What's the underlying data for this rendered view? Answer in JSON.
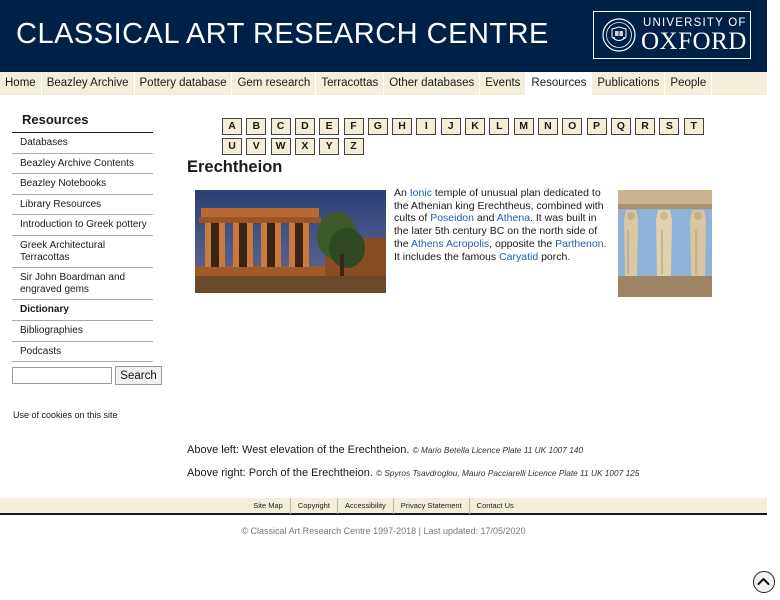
{
  "header": {
    "site_title": "CLASSICAL ART RESEARCH CENTRE",
    "university_of": "UNIVERSITY OF",
    "oxford": "OXFORD"
  },
  "nav": {
    "items": [
      "Home",
      "Beazley Archive",
      "Pottery database",
      "Gem research",
      "Terracottas",
      "Other databases",
      "Events",
      "Resources",
      "Publications",
      "People"
    ],
    "active": "Resources"
  },
  "sidebar": {
    "title": "Resources",
    "items": [
      "Databases",
      "Beazley Archive Contents",
      "Beazley Notebooks",
      "Library Resources",
      "Introduction to Greek pottery",
      "Greek Architectural Terracottas",
      "Sir John Boardman and engraved gems",
      "Dictionary",
      "Bibliographies",
      "Podcasts"
    ],
    "bold_item": "Dictionary"
  },
  "search": {
    "value": "",
    "placeholder": "",
    "button_label": "Search"
  },
  "cookies_link": "Use of cookies on this site",
  "alphabet": {
    "row1": [
      "A",
      "B",
      "C",
      "D",
      "E",
      "F",
      "G",
      "H",
      "I",
      "J",
      "K",
      "L",
      "M",
      "N",
      "O",
      "P",
      "Q",
      "R",
      "S",
      "T"
    ],
    "row2": [
      "U",
      "V",
      "W",
      "X",
      "Y",
      "Z"
    ]
  },
  "main": {
    "title": "Erechtheion",
    "description": {
      "t1": "An ",
      "l1": "Ionic",
      "t2": " temple of unusual plan dedicated to the Athenian king Erechtheus, combined with cults of ",
      "l2": "Poseidon",
      "t3": " and ",
      "l3": "Athena",
      "t4": ". It was built in the later 5th century BC on the north side of the ",
      "l4": "Athens Acropolis",
      "t5": ", opposite the ",
      "l5": "Parthenon",
      "t6": ". It includes the famous ",
      "l6": "Caryatid",
      "t7": " porch."
    },
    "caption_left": {
      "text": "Above left: West elevation of the Erechtheion.",
      "credit": "© Mario Betella Licence Plate 11 UK 1007 140"
    },
    "caption_right": {
      "text": "Above right: Porch of the Erechtheion.",
      "credit": "© Spyros Tsavdroglou, Mauro Pacciarelli Licence Plate 11 UK 1007 125"
    }
  },
  "footer": {
    "links": [
      "Site Map",
      "Copyright",
      "Accessibility",
      "Privacy Statement",
      "Contact Us"
    ],
    "copyright": "© Classical Art Research Centre 1997-2018 | Last updated: 17/05/2020"
  },
  "icons": {
    "seal": "oxford-seal-icon",
    "scroll_top": "chevron-up-icon"
  },
  "colors": {
    "header_bg": "#002147",
    "nav_bg": "#f4eed8",
    "link": "#1f5fb0",
    "letter_bg": "#f4eed8"
  }
}
